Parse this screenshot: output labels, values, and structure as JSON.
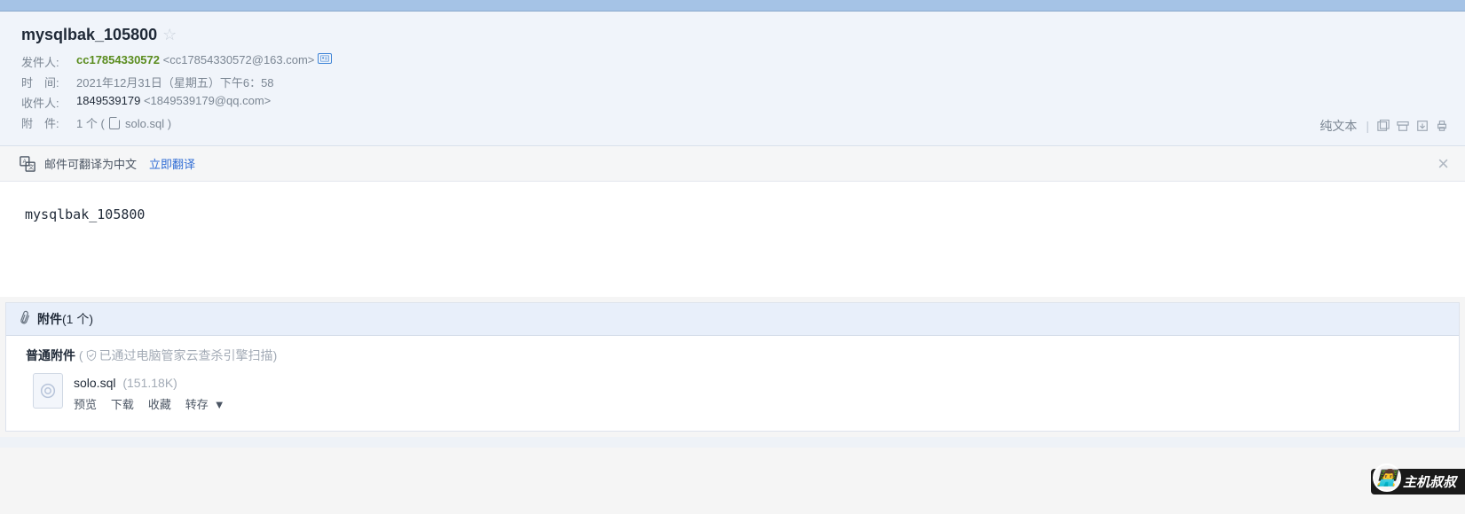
{
  "subject": "mysqlbak_105800",
  "meta": {
    "sender_label": "发件人:",
    "sender_name": "cc17854330572",
    "sender_addr": "<cc17854330572@163.com>",
    "time_label": "时　间:",
    "time_value": "2021年12月31日（星期五）下午6：58",
    "recipient_label": "收件人:",
    "recipient_name": "1849539179",
    "recipient_addr": "<1849539179@qq.com>",
    "attach_label": "附　件:",
    "attach_count_inline": "1 个 (",
    "attach_name_inline": "solo.sql",
    "attach_close_paren": ")"
  },
  "tools": {
    "plaintext": "纯文本"
  },
  "translate": {
    "msg": "邮件可翻译为中文",
    "link": "立即翻译"
  },
  "body_text": "mysqlbak_105800",
  "attach_section": {
    "title": "附件",
    "count": "(1 个)",
    "normal_label": "普通附件",
    "scan_prefix": "(",
    "scan_text": "已通过电脑管家云查杀引擎扫描",
    "scan_suffix": ")",
    "file_name": "solo.sql",
    "file_size": "(151.18K)",
    "actions": {
      "preview": "预览",
      "download": "下载",
      "favorite": "收藏",
      "transfer": "转存"
    }
  },
  "watermark_text": "主机叔叔"
}
